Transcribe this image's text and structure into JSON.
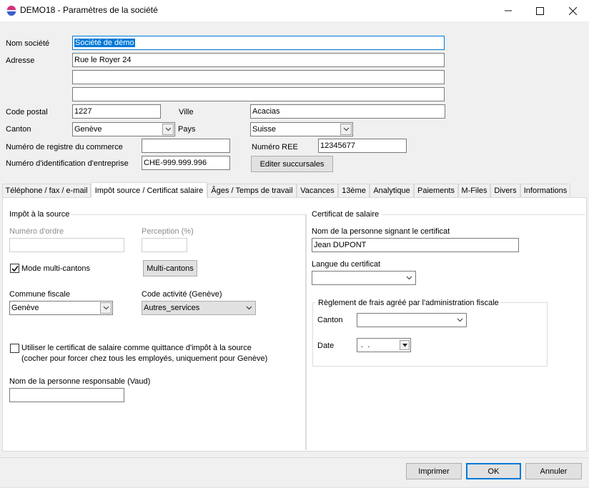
{
  "window": {
    "title": "DEMO18 - Paramètres de la société",
    "icon": "app-logo-icon",
    "controls": [
      "minimize-icon",
      "maximize-icon",
      "close-icon"
    ]
  },
  "company": {
    "nom_societe_label": "Nom société",
    "nom_societe_value": "Société de démo",
    "adresse_label": "Adresse",
    "adresse_line1": "Rue le Royer 24",
    "adresse_line2": "",
    "adresse_line3": "",
    "code_postal_label": "Code postal",
    "code_postal_value": "1227",
    "ville_label": "Ville",
    "ville_value": "Acacias",
    "canton_label": "Canton",
    "canton_value": "Genève",
    "pays_label": "Pays",
    "pays_value": "Suisse",
    "registre_label": "Numéro de registre du commerce",
    "registre_value": "",
    "ree_label": "Numéro REE",
    "ree_value": "12345677",
    "ide_label": "Numéro d'identification d'entreprise",
    "ide_value": "CHE-999.999.996",
    "succursales_button": "Editer succursales"
  },
  "tabs": [
    {
      "label": "Téléphone / fax / e-mail",
      "active": false
    },
    {
      "label": "Impôt source / Certificat salaire",
      "active": true
    },
    {
      "label": "Âges / Temps de travail",
      "active": false
    },
    {
      "label": "Vacances",
      "active": false
    },
    {
      "label": "13ème",
      "active": false
    },
    {
      "label": "Analytique",
      "active": false
    },
    {
      "label": "Paiements",
      "active": false
    },
    {
      "label": "M-Files",
      "active": false
    },
    {
      "label": "Divers",
      "active": false
    },
    {
      "label": "Informations",
      "active": false
    }
  ],
  "impot_source": {
    "group_title": "Impôt à la source",
    "numero_ordre_label": "Numéro d'ordre",
    "numero_ordre_value": "",
    "perception_label": "Perception (%)",
    "perception_value": "",
    "multi_cantons_checkbox": "Mode multi-cantons",
    "multi_cantons_checked": true,
    "multi_cantons_button": "Multi-cantons",
    "commune_label": "Commune fiscale",
    "commune_value": "Genève",
    "code_activite_label": "Code activité (Genève)",
    "code_activite_value": "Autres_services",
    "certificat_checkbox_line1": "Utiliser le certificat de salaire comme quittance d'impôt à la source",
    "certificat_checkbox_line2": "(cocher pour forcer chez tous les employés, uniquement pour Genève)",
    "certificat_checked": false,
    "responsable_label": "Nom de la personne responsable (Vaud)",
    "responsable_value": ""
  },
  "certificat": {
    "group_title": "Certificat de salaire",
    "signataire_label": "Nom de la personne signant le certificat",
    "signataire_value": "Jean DUPONT",
    "langue_label": "Langue du certificat",
    "langue_value": "",
    "reglement_title": "Règlement de frais agréé par l'administration fiscale",
    "canton_label": "Canton",
    "canton_value": "",
    "date_label": "Date",
    "date_value": " .  ."
  },
  "footer": {
    "imprimer": "Imprimer",
    "ok": "OK",
    "annuler": "Annuler"
  },
  "colors": {
    "accent": "#0078d7",
    "window_bg": "#f0f0f0",
    "panel_bg": "#ffffff"
  }
}
